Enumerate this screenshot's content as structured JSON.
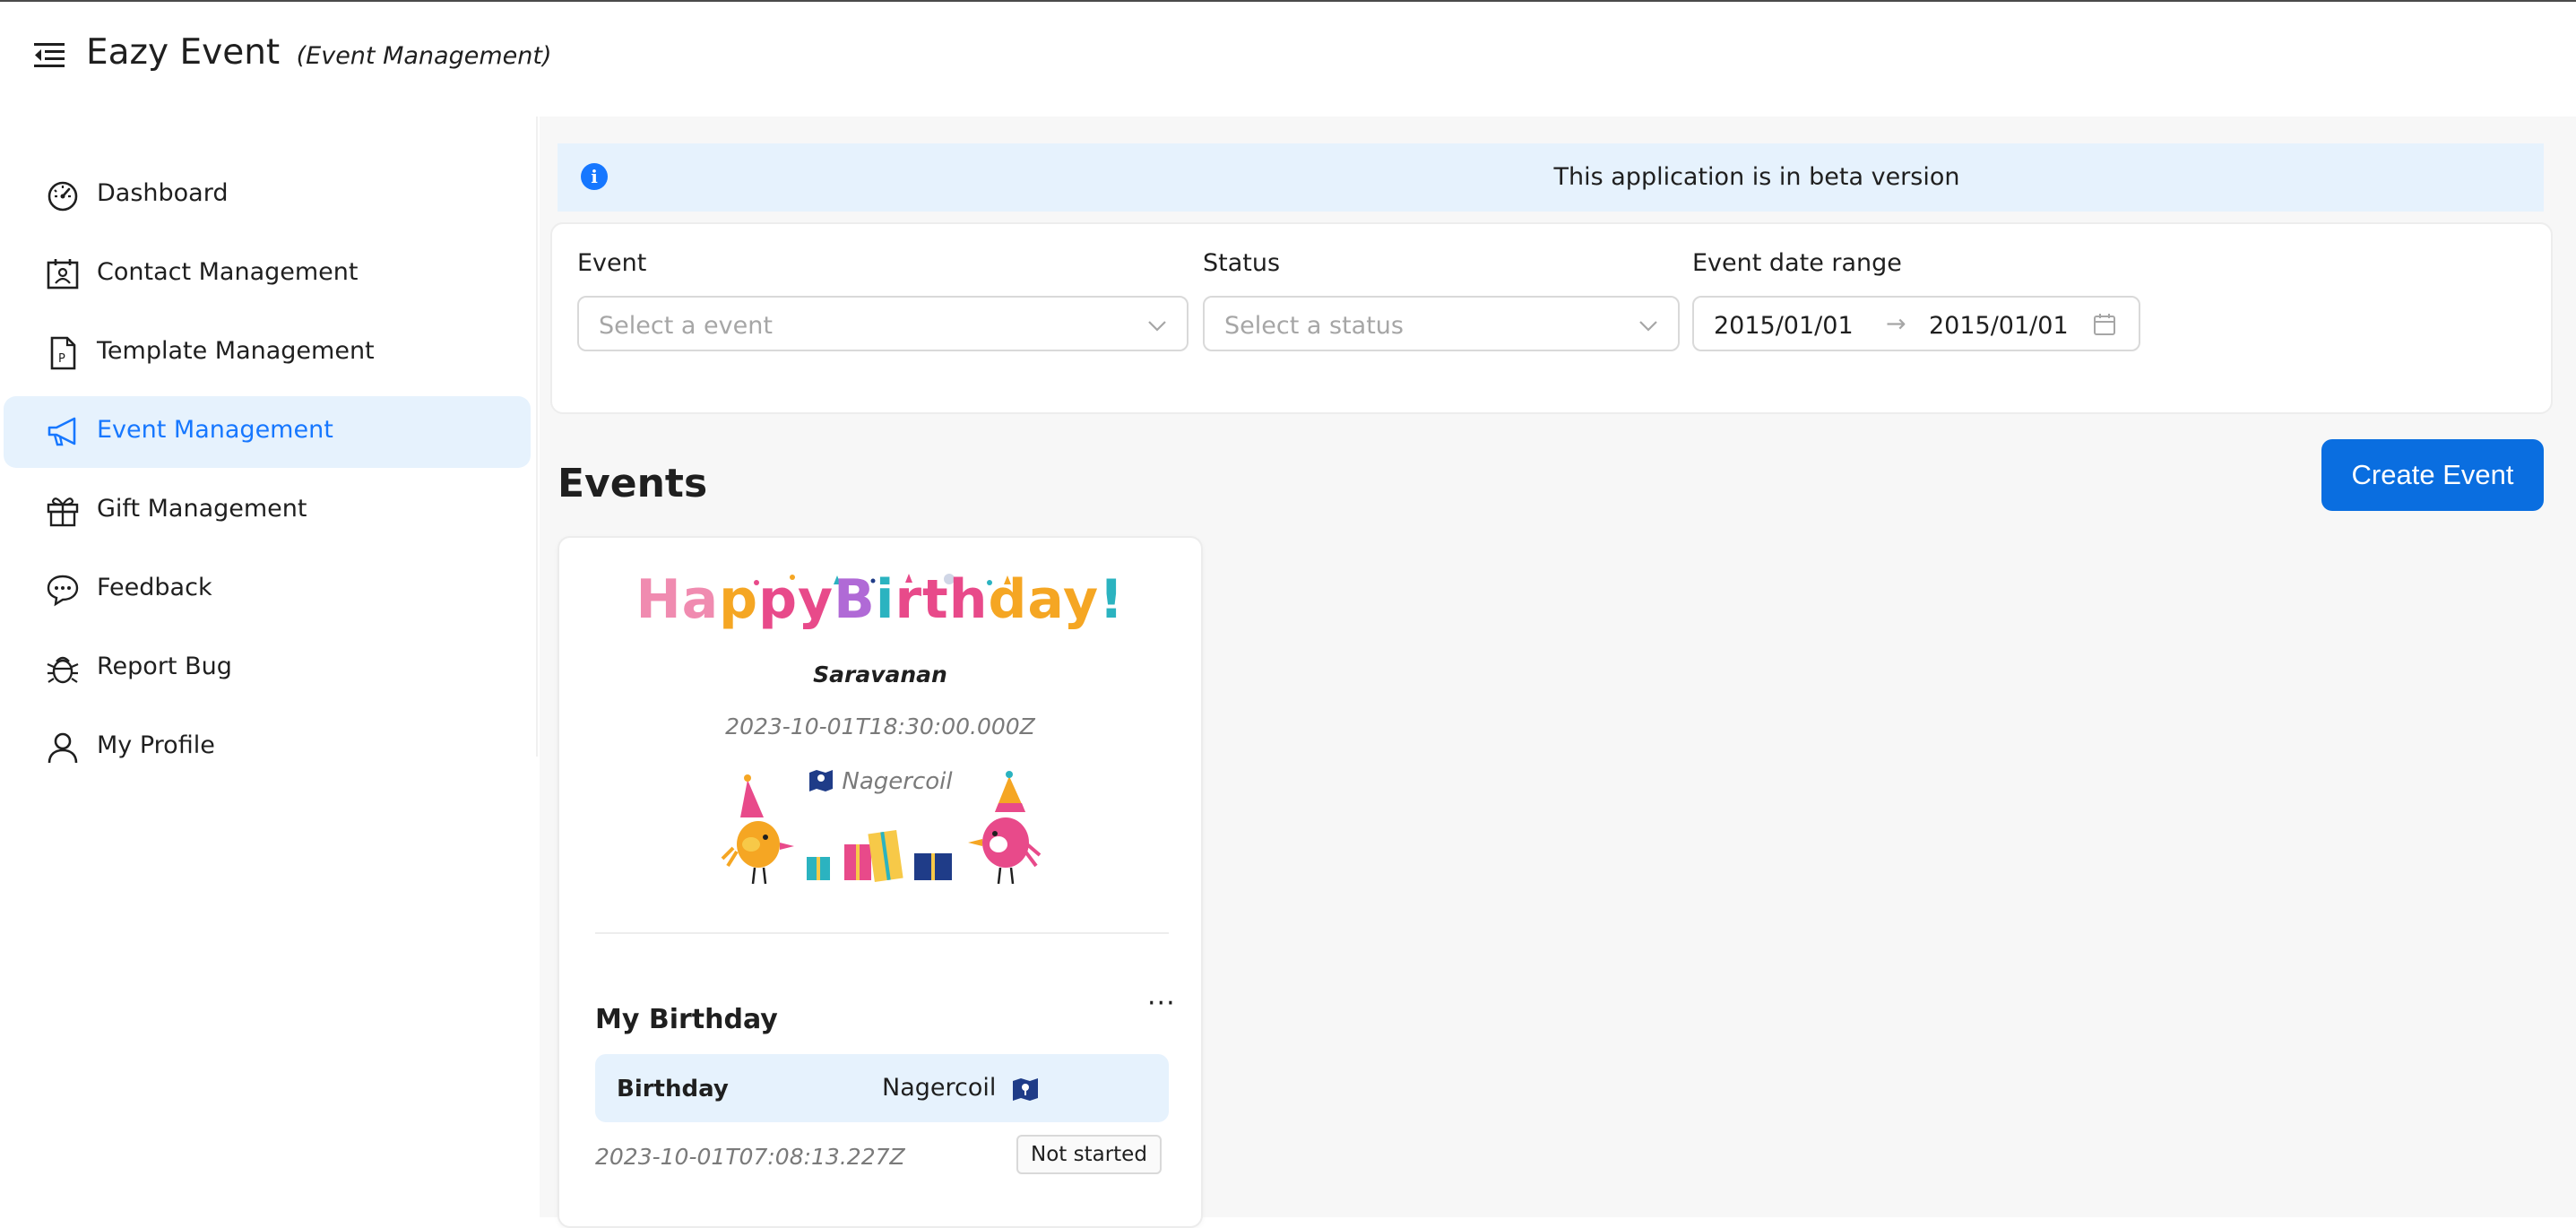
{
  "app": {
    "title": "Eazy Event",
    "subtitle": "(Event Management)"
  },
  "sidebar": {
    "items": [
      {
        "label": "Dashboard",
        "icon": "dashboard-icon",
        "active": false
      },
      {
        "label": "Contact Management",
        "icon": "contact-card-icon",
        "active": false
      },
      {
        "label": "Template Management",
        "icon": "template-file-icon",
        "active": false
      },
      {
        "label": "Event Management",
        "icon": "megaphone-icon",
        "active": true
      },
      {
        "label": "Gift Management",
        "icon": "gift-icon",
        "active": false
      },
      {
        "label": "Feedback",
        "icon": "chat-bubbles-icon",
        "active": false
      },
      {
        "label": "Report Bug",
        "icon": "bug-icon",
        "active": false
      },
      {
        "label": "My Profile",
        "icon": "user-icon",
        "active": false
      }
    ]
  },
  "alert": {
    "text": "This application is in beta version"
  },
  "filters": {
    "event": {
      "label": "Event",
      "placeholder": "Select a event"
    },
    "status": {
      "label": "Status",
      "placeholder": "Select a status"
    },
    "date_range": {
      "label": "Event date range",
      "start": "2015/01/01",
      "end": "2015/01/01",
      "separator": "→"
    }
  },
  "events": {
    "title": "Events",
    "create_label": "Create Event",
    "cards": [
      {
        "cover": {
          "heading": "Happy Birthday!",
          "name": "Saravanan",
          "date": "2023-10-01T18:30:00.000Z",
          "location": "Nagercoil"
        },
        "title": "My Birthday",
        "more": "···",
        "type": "Birthday",
        "location": "Nagercoil",
        "created": "2023-10-01T07:08:13.227Z",
        "status": "Not started"
      }
    ]
  },
  "colors": {
    "accent": "#1677ff",
    "button": "#0a6ee0",
    "active_bg": "#e6f2fd",
    "content_bg": "#f7f7f7"
  }
}
